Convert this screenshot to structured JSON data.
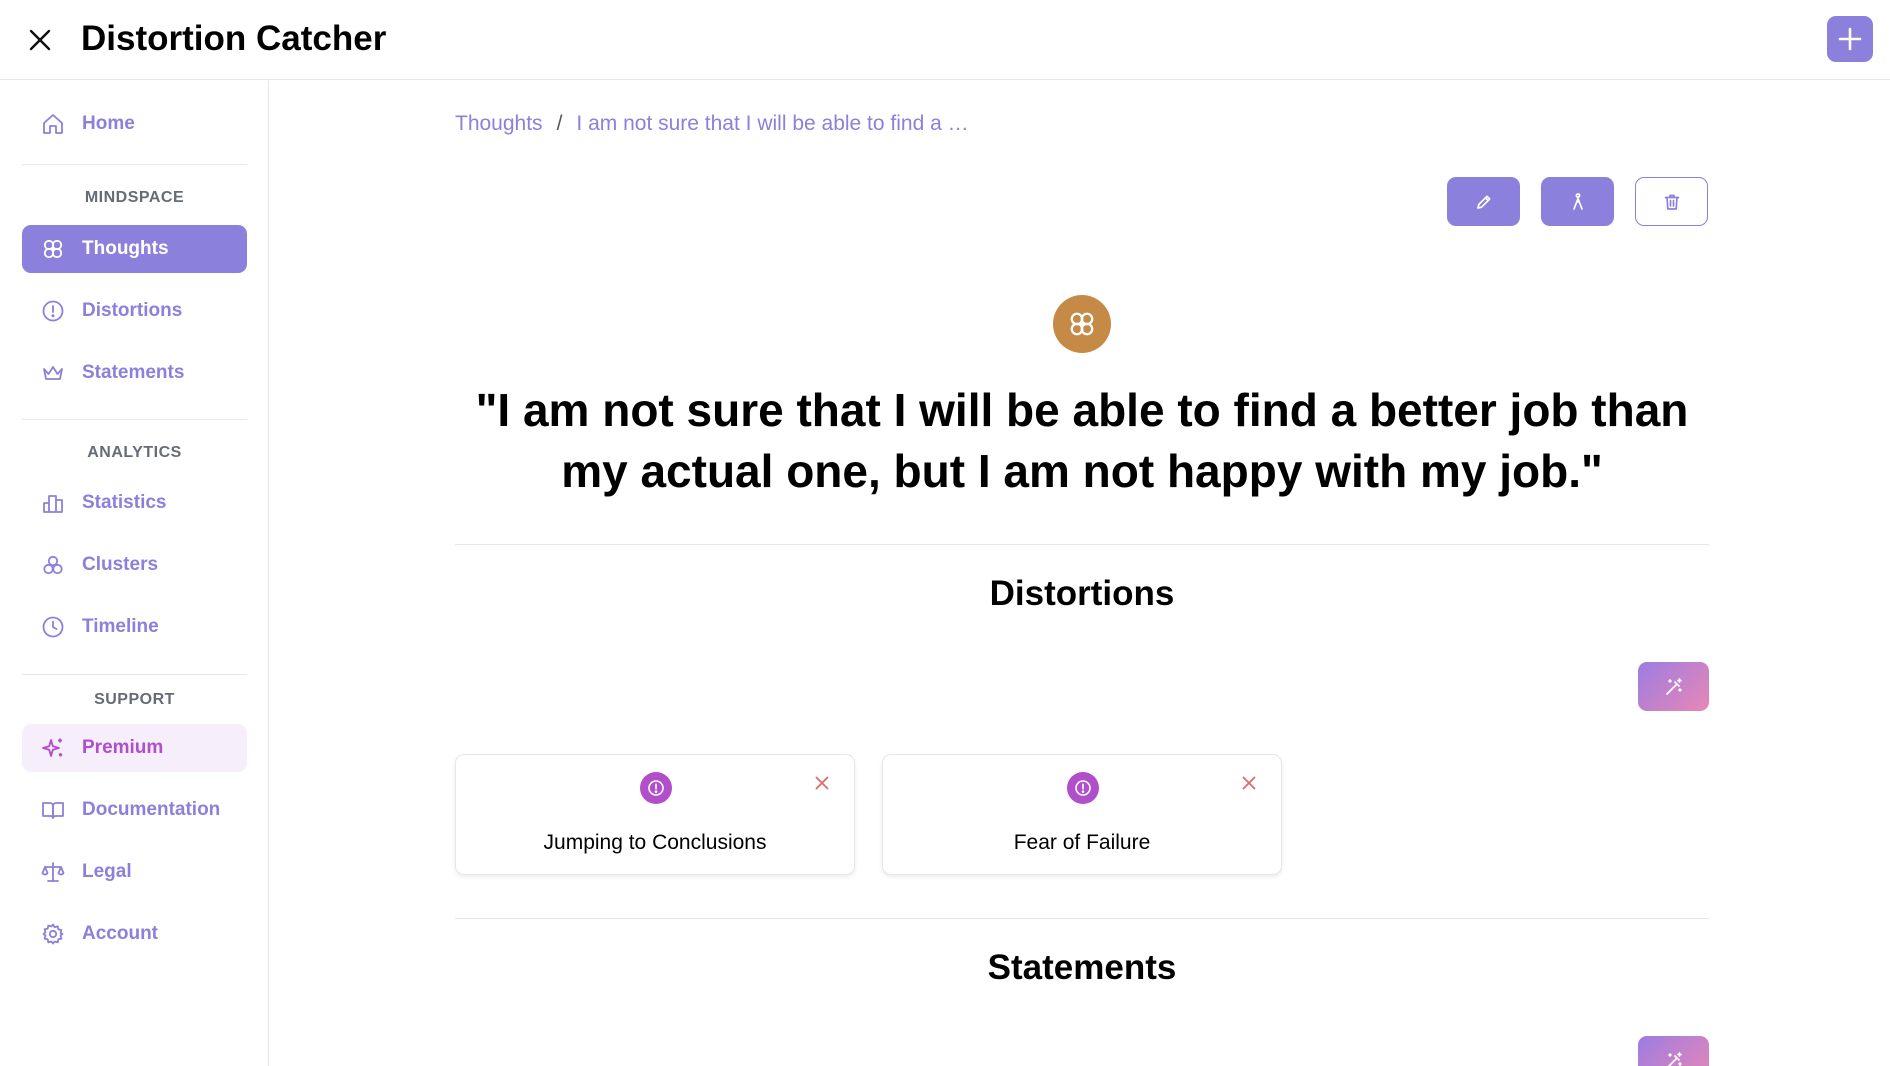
{
  "header": {
    "title": "Distortion Catcher"
  },
  "sidebar": {
    "home": "Home",
    "sections": {
      "mindspace": "MINDSPACE",
      "analytics": "ANALYTICS",
      "support": "SUPPORT"
    },
    "mindspace_items": [
      "Thoughts",
      "Distortions",
      "Statements"
    ],
    "analytics_items": [
      "Statistics",
      "Clusters",
      "Timeline"
    ],
    "support_items": [
      "Premium",
      "Documentation",
      "Legal",
      "Account"
    ],
    "active_item": "Thoughts"
  },
  "breadcrumb": {
    "root": "Thoughts",
    "separator": "/",
    "current": "I am not sure that I will be able to find a …"
  },
  "thought": {
    "text": "\"I am not sure that I will be able to find a better job than my actual one, but I am not happy with my job.\""
  },
  "distortions": {
    "title": "Distortions",
    "items": [
      "Jumping to Conclusions",
      "Fear of Failure"
    ]
  },
  "statements": {
    "title": "Statements"
  },
  "colors": {
    "accent": "#8b80dc",
    "premium": "#b04fc9",
    "thought_icon": "#c58a45",
    "remove": "#e06b6b"
  },
  "icons": {
    "close": "close-icon",
    "add": "plus-icon",
    "edit": "pencil-icon",
    "reframe": "person-arrow-icon",
    "delete": "trash-icon",
    "magic": "magic-wand-icon"
  }
}
